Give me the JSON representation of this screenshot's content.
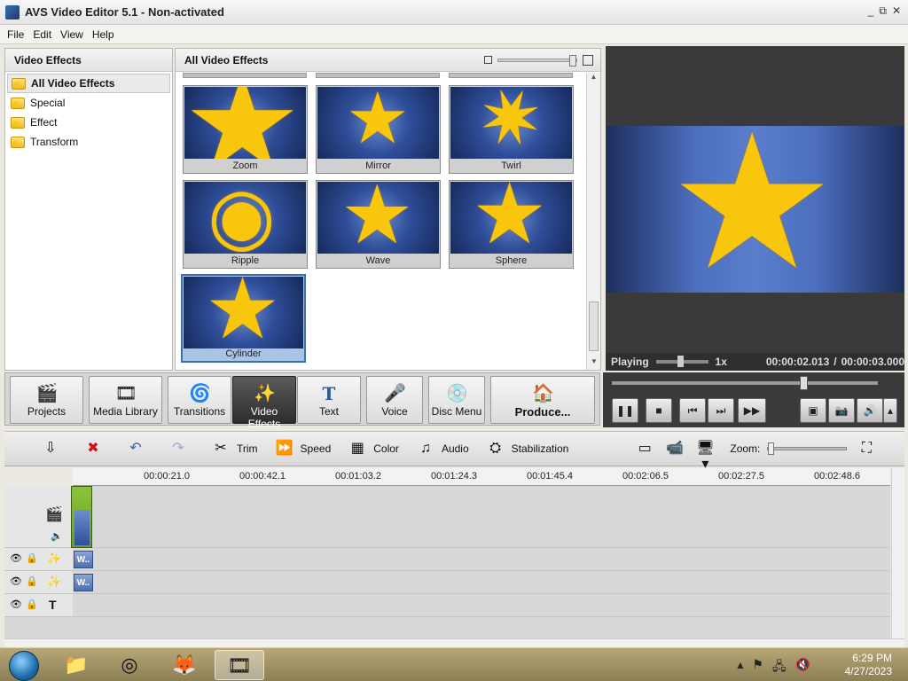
{
  "window": {
    "title": "AVS Video Editor 5.1 - Non-activated",
    "controls": [
      "_",
      "⧉",
      "✕"
    ]
  },
  "menu": {
    "file": "File",
    "edit": "Edit",
    "view": "View",
    "help": "Help"
  },
  "left_panel": {
    "title": "Video Effects",
    "items": [
      "All Video Effects",
      "Special",
      "Effect",
      "Transform"
    ]
  },
  "effects_panel": {
    "title": "All Video Effects",
    "tiles": [
      "Zoom",
      "Mirror",
      "Twirl",
      "Ripple",
      "Wave",
      "Sphere",
      "Cylinder"
    ]
  },
  "preview": {
    "state": "Playing",
    "speed": "1x",
    "current_time": "00:00:02.013",
    "separator": "/",
    "total_time": "00:00:03.000"
  },
  "toolbar": {
    "projects": "Projects",
    "media_library": "Media Library",
    "transitions": "Transitions",
    "video_effects": "Video Effects",
    "text": "Text",
    "voice": "Voice",
    "disc_menu": "Disc Menu",
    "produce": "Produce..."
  },
  "timeline_toolbar": {
    "trim": "Trim",
    "speed": "Speed",
    "color": "Color",
    "audio": "Audio",
    "stabilization": "Stabilization",
    "zoom_label": "Zoom:"
  },
  "ruler": [
    "00:00:21.0",
    "00:00:42.1",
    "00:01:03.2",
    "00:01:24.3",
    "00:01:45.4",
    "00:02:06.5",
    "00:02:27.5",
    "00:02:48.6"
  ],
  "clips": {
    "w1": "W..",
    "w2": "W.."
  },
  "taskbar": {
    "time": "6:29 PM",
    "date": "4/27/2023"
  },
  "colors": {
    "accent_selected": "#3e6fb0",
    "star": "#f8c60c",
    "preview_bg": "#3a3a3a"
  }
}
